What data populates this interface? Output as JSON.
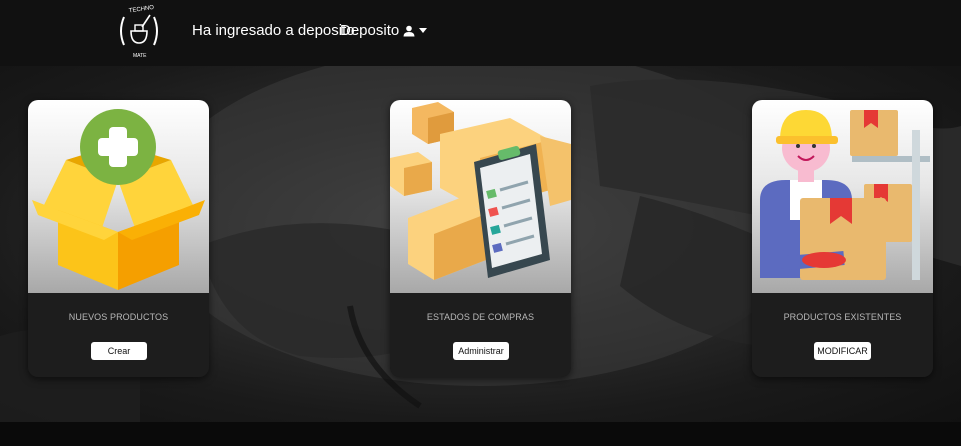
{
  "navbar": {
    "logo_text_top": "TECHNO",
    "logo_text_bottom": "MATE",
    "welcome_text": "Ha ingresado a deposito",
    "user_menu_label": "Deposito"
  },
  "cards": [
    {
      "title": "NUEVOS PRODUCTOS",
      "button_label": "Crear",
      "image_icon": "open-box-plus-icon"
    },
    {
      "title": "ESTADOS DE COMPRAS",
      "button_label": "Administrar",
      "image_icon": "boxes-clipboard-icon"
    },
    {
      "title": "PRODUCTOS EXISTENTES",
      "button_label": "MODIFICAR",
      "image_icon": "worker-boxes-icon"
    }
  ],
  "colors": {
    "navbar_bg": "#111111",
    "card_body_bg": "#1d1d1d",
    "box_yellow": "#fcc419",
    "plus_green": "#7cb342",
    "box_tan": "#e9b96e"
  }
}
